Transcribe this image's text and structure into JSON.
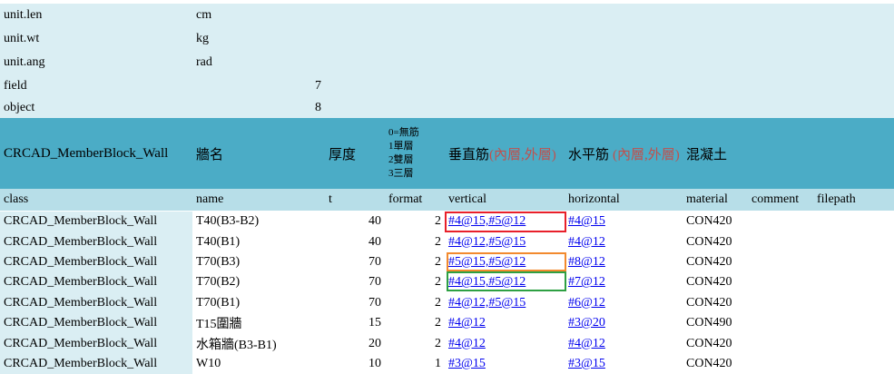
{
  "meta_rows": [
    {
      "key": "unit.len",
      "value": "cm"
    },
    {
      "key": "unit.wt",
      "value": "kg"
    },
    {
      "key": "unit.ang",
      "value": "rad"
    }
  ],
  "count_rows": [
    {
      "key": "field",
      "value": "7"
    },
    {
      "key": "object",
      "value": "8"
    }
  ],
  "header_cn": {
    "class": "CRCAD_MemberBlock_Wall",
    "name": "牆名",
    "t": "厚度",
    "format_lines": [
      "0=無筋",
      "1單層",
      "2雙層",
      "3三層"
    ],
    "vertical": "垂直筋",
    "vertical_note": "(內層,外層)",
    "horizontal": "水平筋",
    "horizontal_note": "(內層,外層)",
    "material": "混凝土"
  },
  "header_en": {
    "class": "class",
    "name": "name",
    "t": "t",
    "format": "format",
    "vertical": "vertical",
    "horizontal": "horizontal",
    "material": "material",
    "comment": "comment",
    "filepath": "filepath"
  },
  "rows": [
    {
      "class": "CRCAD_MemberBlock_Wall",
      "name": "T40(B3-B2)",
      "t": "40",
      "format": "2",
      "vertical": "#4@15,#5@12",
      "horizontal": "#4@15",
      "material": "CON420"
    },
    {
      "class": "CRCAD_MemberBlock_Wall",
      "name": "T40(B1)",
      "t": "40",
      "format": "2",
      "vertical": "#4@12,#5@15",
      "horizontal": "#4@12",
      "material": "CON420"
    },
    {
      "class": "CRCAD_MemberBlock_Wall",
      "name": "T70(B3)",
      "t": "70",
      "format": "2",
      "vertical": "#5@15,#5@12",
      "horizontal": "#8@12",
      "material": "CON420"
    },
    {
      "class": "CRCAD_MemberBlock_Wall",
      "name": "T70(B2)",
      "t": "70",
      "format": "2",
      "vertical": "#4@15,#5@12",
      "horizontal": "#7@12",
      "material": "CON420"
    },
    {
      "class": "CRCAD_MemberBlock_Wall",
      "name": "T70(B1)",
      "t": "70",
      "format": "2",
      "vertical": "#4@12,#5@15",
      "horizontal": "#6@12",
      "material": "CON420"
    },
    {
      "class": "CRCAD_MemberBlock_Wall",
      "name": "T15圍牆",
      "t": "15",
      "format": "2",
      "vertical": "#4@12",
      "horizontal": "#3@20",
      "material": "CON490"
    },
    {
      "class": "CRCAD_MemberBlock_Wall",
      "name": "水箱牆(B3-B1)",
      "t": "20",
      "format": "2",
      "vertical": "#4@12",
      "horizontal": "#4@12",
      "material": "CON420"
    },
    {
      "class": "CRCAD_MemberBlock_Wall",
      "name": "W10",
      "t": "10",
      "format": "1",
      "vertical": "#3@15",
      "horizontal": "#3@15",
      "material": "CON420"
    }
  ],
  "highlight_colors": {
    "red": "#e8202a",
    "orange": "#f28a2e",
    "green": "#2ea043"
  },
  "colors": {
    "light": "#daeef3",
    "teal": "#4bacc6",
    "pale": "#b7dee8",
    "link": "#0000ee",
    "note": "#c0504d"
  }
}
